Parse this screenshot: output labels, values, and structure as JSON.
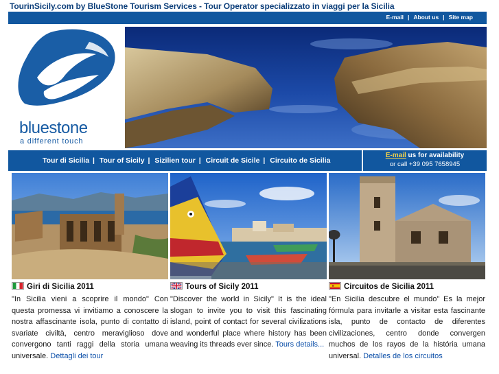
{
  "page": {
    "title": "TourinSicily.com by BlueStone Tourism Services - Tour Operator specializzato in viaggi per la Sicilia"
  },
  "top_links": [
    {
      "label": "E-mail"
    },
    {
      "label": "About us"
    },
    {
      "label": "Site map"
    }
  ],
  "logo": {
    "word": "bluestone",
    "tagline": "a different touch"
  },
  "nav": [
    {
      "label": "Tour di Sicilia"
    },
    {
      "label": "Tour of Sicily"
    },
    {
      "label": "Sizilien tour"
    },
    {
      "label": "Circuit de Sicile"
    },
    {
      "label": "Circuito de Sicilia"
    }
  ],
  "contact": {
    "email_label": "E-mail",
    "line1_rest": " us for availability",
    "line2": "or call +39 095 7658945"
  },
  "cards": [
    {
      "flag": "italy-flag",
      "title": "Giri di Sicilia 2011",
      "text": "\"In Sicilia vieni a scoprire il mondo\" Con questa promessa vi invitiamo a conoscere la nostra affascinante isola, punto di contatto di svariate civiltà, centro meraviglioso dove convergono tanti raggi della storia umana universale. ",
      "link": "Dettagli dei tour"
    },
    {
      "flag": "uk-flag",
      "title": "Tours of Sicily 2011",
      "text": "\"Discover the world in Sicily\" It is the ideal slogan to invite you to visit this fascinating island, point of contact for several civilizations and wonderful place where history has been weaving its threads ever since. ",
      "link": "Tours details..."
    },
    {
      "flag": "spain-flag",
      "title": "Circuitos de Sicilia 2011",
      "text": "\"En Sicilia descubre el mundo\" Es la mejor fórmula para invitarle a visitar esta fascinante isla, punto de contacto de diferentes civilizaciones, centro donde convergen muchos de los rayos de la história umana universal. ",
      "link": "Detalles de los circuitos"
    }
  ]
}
